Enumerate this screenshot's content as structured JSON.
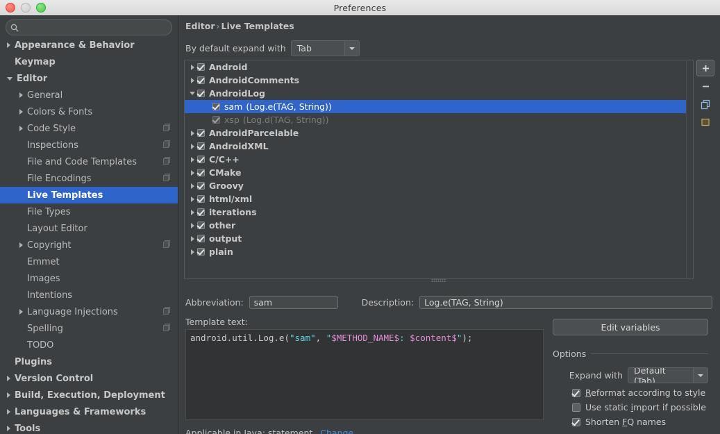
{
  "window": {
    "title": "Preferences",
    "controls": [
      "close-button",
      "minimize-button",
      "zoom-button"
    ]
  },
  "sidebar": {
    "search": {
      "value": "",
      "placeholder": "",
      "icon": "search-icon"
    },
    "items": [
      {
        "label": "Appearance & Behavior",
        "arrow": "right",
        "indent": 0,
        "bold": true,
        "selected": false,
        "scope_icon": false
      },
      {
        "label": "Keymap",
        "arrow": "none",
        "indent": 0,
        "bold": true,
        "selected": false,
        "scope_icon": false
      },
      {
        "label": "Editor",
        "arrow": "down",
        "indent": 0,
        "bold": true,
        "selected": false,
        "scope_icon": false
      },
      {
        "label": "General",
        "arrow": "right",
        "indent": 1,
        "bold": false,
        "selected": false,
        "scope_icon": false
      },
      {
        "label": "Colors & Fonts",
        "arrow": "right",
        "indent": 1,
        "bold": false,
        "selected": false,
        "scope_icon": false
      },
      {
        "label": "Code Style",
        "arrow": "right",
        "indent": 1,
        "bold": false,
        "selected": false,
        "scope_icon": true
      },
      {
        "label": "Inspections",
        "arrow": "none",
        "indent": 1,
        "bold": false,
        "selected": false,
        "scope_icon": true
      },
      {
        "label": "File and Code Templates",
        "arrow": "none",
        "indent": 1,
        "bold": false,
        "selected": false,
        "scope_icon": true
      },
      {
        "label": "File Encodings",
        "arrow": "none",
        "indent": 1,
        "bold": false,
        "selected": false,
        "scope_icon": true
      },
      {
        "label": "Live Templates",
        "arrow": "none",
        "indent": 1,
        "bold": false,
        "selected": true,
        "scope_icon": false
      },
      {
        "label": "File Types",
        "arrow": "none",
        "indent": 1,
        "bold": false,
        "selected": false,
        "scope_icon": false
      },
      {
        "label": "Layout Editor",
        "arrow": "none",
        "indent": 1,
        "bold": false,
        "selected": false,
        "scope_icon": false
      },
      {
        "label": "Copyright",
        "arrow": "right",
        "indent": 1,
        "bold": false,
        "selected": false,
        "scope_icon": true
      },
      {
        "label": "Emmet",
        "arrow": "none",
        "indent": 1,
        "bold": false,
        "selected": false,
        "scope_icon": false
      },
      {
        "label": "Images",
        "arrow": "none",
        "indent": 1,
        "bold": false,
        "selected": false,
        "scope_icon": false
      },
      {
        "label": "Intentions",
        "arrow": "none",
        "indent": 1,
        "bold": false,
        "selected": false,
        "scope_icon": false
      },
      {
        "label": "Language Injections",
        "arrow": "right",
        "indent": 1,
        "bold": false,
        "selected": false,
        "scope_icon": true
      },
      {
        "label": "Spelling",
        "arrow": "none",
        "indent": 1,
        "bold": false,
        "selected": false,
        "scope_icon": true
      },
      {
        "label": "TODO",
        "arrow": "none",
        "indent": 1,
        "bold": false,
        "selected": false,
        "scope_icon": false
      },
      {
        "label": "Plugins",
        "arrow": "none",
        "indent": 0,
        "bold": true,
        "selected": false,
        "scope_icon": false
      },
      {
        "label": "Version Control",
        "arrow": "right",
        "indent": 0,
        "bold": true,
        "selected": false,
        "scope_icon": false
      },
      {
        "label": "Build, Execution, Deployment",
        "arrow": "right",
        "indent": 0,
        "bold": true,
        "selected": false,
        "scope_icon": false
      },
      {
        "label": "Languages & Frameworks",
        "arrow": "right",
        "indent": 0,
        "bold": true,
        "selected": false,
        "scope_icon": false
      },
      {
        "label": "Tools",
        "arrow": "right",
        "indent": 0,
        "bold": true,
        "selected": false,
        "scope_icon": false
      }
    ]
  },
  "main": {
    "breadcrumb": {
      "root": "Editor",
      "separator": "›",
      "leaf": "Live Templates"
    },
    "expand_with": {
      "label": "By default expand with",
      "value": "Tab"
    },
    "tree_toolbar": [
      {
        "name": "add-template-button",
        "glyph": "+"
      },
      {
        "name": "remove-template-button",
        "glyph": "−"
      },
      {
        "name": "duplicate-template-button",
        "glyph": "copy"
      },
      {
        "name": "template-group-button",
        "glyph": "folder"
      }
    ],
    "template_tree": [
      {
        "label": "Android",
        "detail": "",
        "arrow": "right",
        "checked": true,
        "level": 0,
        "selected": false,
        "dim": false
      },
      {
        "label": "AndroidComments",
        "detail": "",
        "arrow": "right",
        "checked": true,
        "level": 0,
        "selected": false,
        "dim": false
      },
      {
        "label": "AndroidLog",
        "detail": "",
        "arrow": "down",
        "checked": true,
        "level": 0,
        "selected": false,
        "dim": false
      },
      {
        "label": "sam",
        "detail": "(Log.e(TAG, String))",
        "arrow": "none",
        "checked": true,
        "level": 1,
        "selected": true,
        "dim": false
      },
      {
        "label": "xsp",
        "detail": "(Log.d(TAG, String))",
        "arrow": "none",
        "checked": true,
        "level": 1,
        "selected": false,
        "dim": true
      },
      {
        "label": "AndroidParcelable",
        "detail": "",
        "arrow": "right",
        "checked": true,
        "level": 0,
        "selected": false,
        "dim": false
      },
      {
        "label": "AndroidXML",
        "detail": "",
        "arrow": "right",
        "checked": true,
        "level": 0,
        "selected": false,
        "dim": false
      },
      {
        "label": "C/C++",
        "detail": "",
        "arrow": "right",
        "checked": true,
        "level": 0,
        "selected": false,
        "dim": false
      },
      {
        "label": "CMake",
        "detail": "",
        "arrow": "right",
        "checked": true,
        "level": 0,
        "selected": false,
        "dim": false
      },
      {
        "label": "Groovy",
        "detail": "",
        "arrow": "right",
        "checked": true,
        "level": 0,
        "selected": false,
        "dim": false
      },
      {
        "label": "html/xml",
        "detail": "",
        "arrow": "right",
        "checked": true,
        "level": 0,
        "selected": false,
        "dim": false
      },
      {
        "label": "iterations",
        "detail": "",
        "arrow": "right",
        "checked": true,
        "level": 0,
        "selected": false,
        "dim": false
      },
      {
        "label": "other",
        "detail": "",
        "arrow": "right",
        "checked": true,
        "level": 0,
        "selected": false,
        "dim": false
      },
      {
        "label": "output",
        "detail": "",
        "arrow": "right",
        "checked": true,
        "level": 0,
        "selected": false,
        "dim": false
      },
      {
        "label": "plain",
        "detail": "",
        "arrow": "right",
        "checked": true,
        "level": 0,
        "selected": false,
        "dim": false
      }
    ],
    "details": {
      "abbreviation_label": "Abbreviation:",
      "abbreviation_value": "sam",
      "description_label": "Description:",
      "description_value": "Log.e(TAG, String)",
      "template_text_label": "Template text:",
      "template_text": {
        "p1": "android.util.Log.e(",
        "s1": "\"sam\"",
        "p2": ", ",
        "q1": "\"",
        "v1": "$METHOD_NAME$",
        "c1": ": ",
        "v2": "$content$",
        "q2": "\"",
        "p3": ");"
      },
      "applicable_text": "Applicable in Java: statement.",
      "change_link": "Change"
    },
    "options": {
      "edit_variables_button": "Edit variables",
      "group_title": "Options",
      "expand_with_label": "Expand with",
      "expand_with_value": "Default (Tab)",
      "checkboxes": [
        {
          "label_pre": "",
          "mnemonic": "R",
          "label_post": "eformat according to style",
          "checked": true
        },
        {
          "label_pre": "Use static ",
          "mnemonic": "i",
          "label_post": "mport if possible",
          "checked": false
        },
        {
          "label_pre": "Shorten ",
          "mnemonic": "F",
          "label_post": "Q names",
          "checked": true
        }
      ]
    }
  },
  "colors": {
    "selection_blue": "#2f65ca",
    "panel_bg": "#3c3f41",
    "editor_bg": "#313335",
    "link_blue": "#4a8bd8",
    "string_cyan": "#5fd7e8",
    "variable_pink": "#e58fd8"
  }
}
